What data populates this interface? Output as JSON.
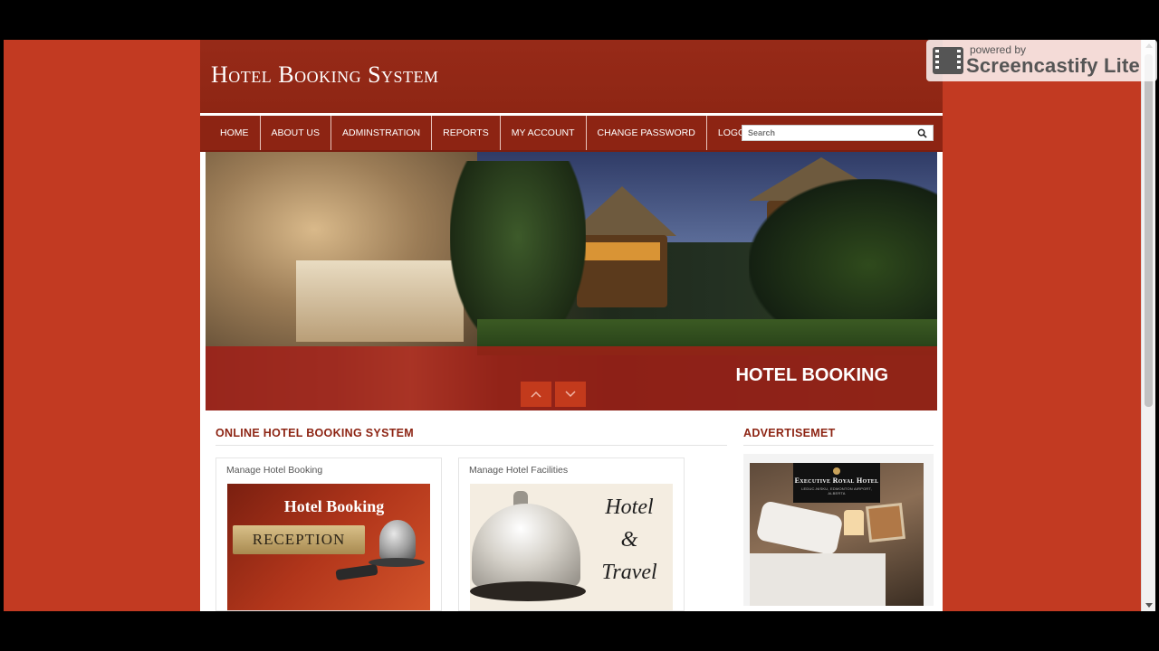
{
  "header": {
    "site_title": "Hotel Booking System"
  },
  "nav": {
    "items": [
      "HOME",
      "ABOUT US",
      "ADMINSTRATION",
      "REPORTS",
      "MY ACCOUNT",
      "CHANGE PASSWORD",
      "LOGOUT"
    ],
    "search_placeholder": "Search"
  },
  "banner": {
    "caption": "HOTEL BOOKING"
  },
  "main": {
    "section_title": "ONLINE HOTEL BOOKING SYSTEM",
    "cards": [
      {
        "title": "Manage Hotel Booking",
        "image_text_top": "Hotel Booking",
        "image_text_sign": "RECEPTION"
      },
      {
        "title": "Manage Hotel Facilities",
        "image_text": [
          "Hotel",
          "&",
          "Travel"
        ]
      }
    ]
  },
  "sidebar": {
    "section_title": "ADVERTISEMET",
    "ad": {
      "logo_name": "Executive Royal Hotel",
      "logo_sub": "LEDUC-NISKU, EDMONTON AIRPORT, ALBERTA"
    }
  },
  "watermark": {
    "small": "powered by",
    "big": "Screencastify Lite"
  },
  "colors": {
    "background": "#c23a22",
    "header": "#8d2413",
    "accent": "#8d2413"
  }
}
